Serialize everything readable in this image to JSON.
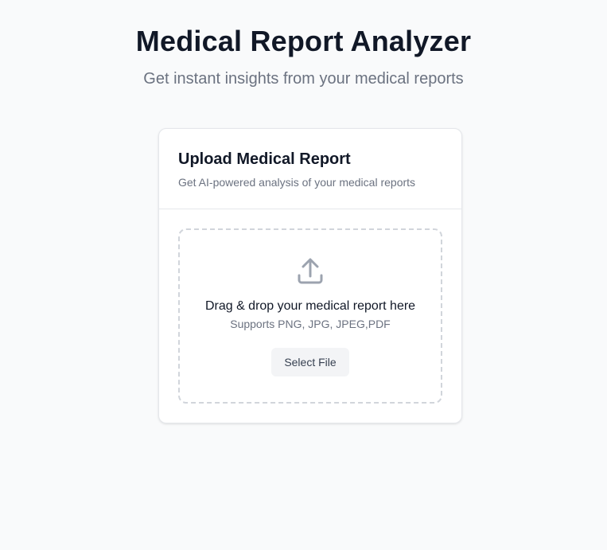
{
  "header": {
    "title": "Medical Report Analyzer",
    "subtitle": "Get instant insights from your medical reports"
  },
  "card": {
    "title": "Upload Medical Report",
    "description": "Get AI-powered analysis of your medical reports"
  },
  "dropzone": {
    "icon": "upload-icon",
    "instruction": "Drag & drop your medical report here",
    "supported_formats": "Supports PNG, JPG, JPEG,PDF",
    "button_label": "Select File"
  },
  "colors": {
    "background": "#f9fafb",
    "title": "#111827",
    "muted": "#6b7280",
    "border": "#e5e7eb",
    "dashed_border": "#d1d5db",
    "icon": "#9ca3af",
    "button_bg": "#f3f4f6"
  }
}
